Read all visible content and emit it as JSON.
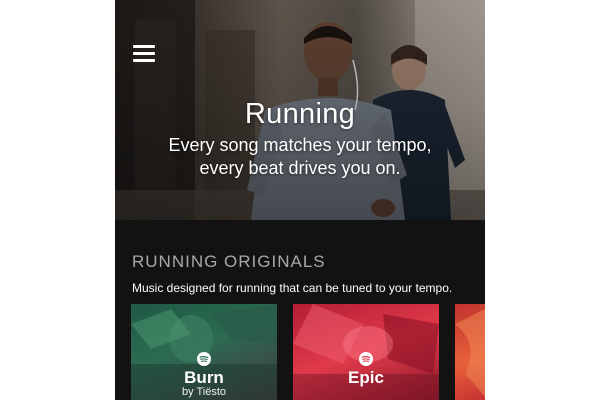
{
  "hero": {
    "title": "Running",
    "subtitle_line1": "Every song matches your tempo,",
    "subtitle_line2": "every beat drives you on."
  },
  "menu": {
    "icon": "hamburger-menu-icon"
  },
  "section": {
    "title": "RUNNING ORIGINALS",
    "description": "Music designed for running that can be tuned to your tempo."
  },
  "cards": [
    {
      "title": "Burn",
      "subtitle": "by Tiësto",
      "icon": "spotify-icon",
      "color": "#2c6b52"
    },
    {
      "title": "Epic",
      "subtitle": "",
      "icon": "spotify-icon",
      "color": "#e03a4a"
    },
    {
      "title": "",
      "subtitle": "",
      "icon": "",
      "color": "#e8603b"
    }
  ],
  "colors": {
    "background": "#121212",
    "section_title": "#a8a8a8",
    "text": "#ffffff"
  }
}
